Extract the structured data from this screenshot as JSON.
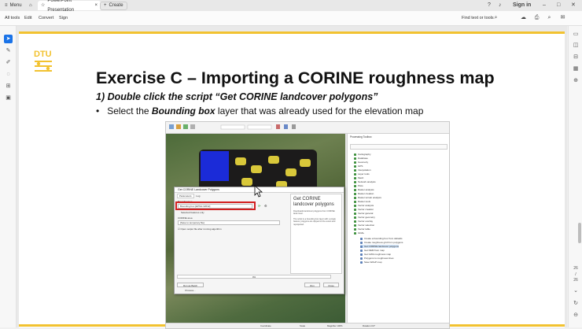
{
  "browser": {
    "tabs": [
      {
        "label": "Menu"
      },
      {
        "label": "PowerPoint Presentation"
      },
      {
        "label": "Create"
      }
    ],
    "sign_in": "Sign in"
  },
  "toolbar": {
    "items": [
      "All tools",
      "Edit",
      "Convert",
      "Sign"
    ],
    "find_label": "Find text or tools"
  },
  "right_rail": {
    "page_current": "26",
    "page_separator": "/",
    "page_total": "26"
  },
  "slide": {
    "title": "Exercise C – Importing a CORINE roughness map",
    "subtitle": "1) Double click the script “Get CORINE landcover polygons”",
    "bullet_prefix": "Select the ",
    "bullet_bold": "Bounding box",
    "bullet_suffix": " layer that was already used for the elevation map",
    "logo_text": "DTU",
    "accent": "#f2c230"
  },
  "qgis": {
    "processing_title": "Processing Toolbox",
    "provider_items": [
      "Cartography",
      "Database",
      "Geometry",
      "GPS",
      "Interpolation",
      "Layer tools",
      "Mesh",
      "Network analysis",
      "Plots",
      "Raster analysis",
      "Raster creation",
      "Raster terrain analysis",
      "Raster tools",
      "Vector analysis",
      "Vector creation",
      "Vector general",
      "Vector geometry",
      "Vector overlay",
      "Vector selection",
      "Vector table",
      "GDAL"
    ],
    "script_items": [
      "Create a bounding box from defaults",
      "Create roughness grid from polygons",
      "Get CORINE landcover polygons",
      "Get DEM from map",
      "Get GWA roughness map",
      "Polygons to roughness lines",
      "Save WAsP map"
    ],
    "highlighted_script": "Get CORINE landcover polygons",
    "dialog": {
      "title": "Get CORINE Landcover Polygons",
      "tabs": [
        "Parameters",
        "Log"
      ],
      "bbox_label": "Bounding box",
      "bbox_value": "Bounding box [EPSG:32632]",
      "selected_only": "Selected features only",
      "output_label": "CORINE area",
      "output_value": "[Save to temporary file]",
      "open_after": "Open output file after running algorithm",
      "help_title": "Get CORINE landcover polygons",
      "help_text_1": "Downloads landcover polygons from CORINE land cover.",
      "help_text_2": "The script is a bounding box layer with a single feature; polygons are clipped to the extent and reprojected.",
      "progress": "0%",
      "btn_batch": "Run as Batch Process...",
      "btn_run": "Run",
      "btn_close": "Close"
    },
    "status": {
      "coordinate": "Coordinate",
      "scale": "Scale",
      "magnifier": "Magnifier 100%",
      "rotation": "Rotation 0.0°"
    }
  }
}
